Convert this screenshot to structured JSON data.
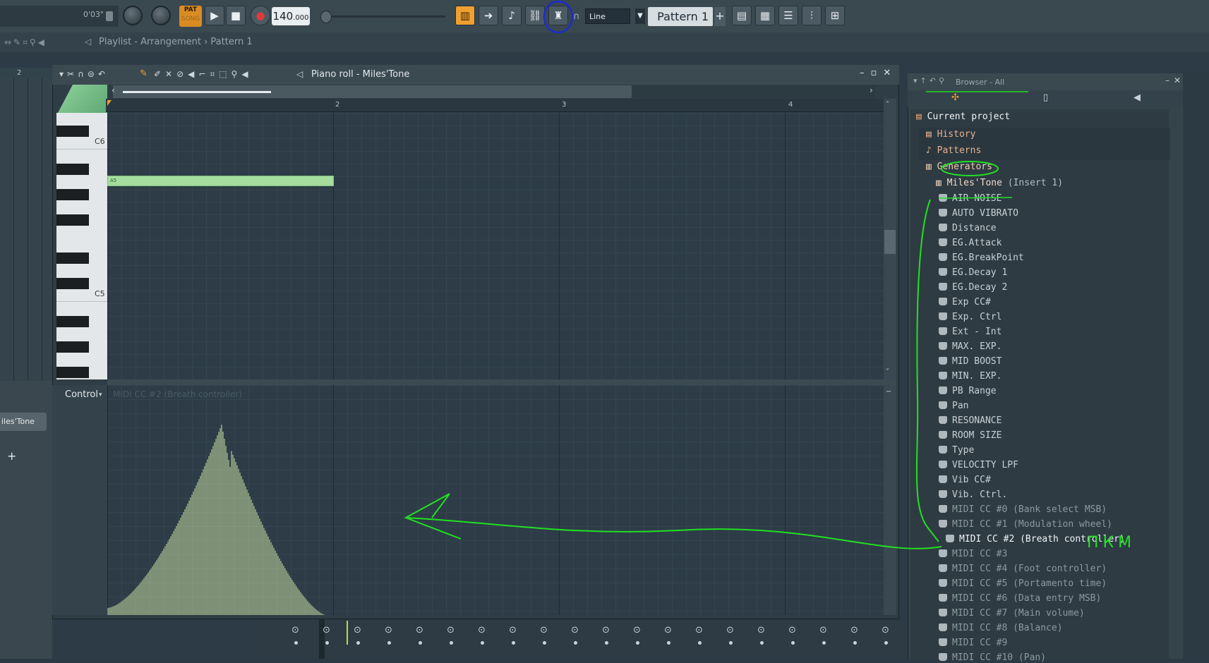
{
  "toolbar": {
    "time": "0'03\"",
    "pat_label": "PAT",
    "song_label": "SONG",
    "tempo_main": "140",
    "tempo_fraction": ".000",
    "snap": "Line",
    "pattern": "Pattern 1",
    "plus": "+"
  },
  "subbar": {
    "title": "Playlist - Arrangement › Pattern 1"
  },
  "piano_roll": {
    "title": "Piano roll - Miles'Tone",
    "ruler": [
      "2",
      "3",
      "4"
    ],
    "octaves": [
      "C6",
      "C5"
    ],
    "note_label": "A5",
    "control_label": "Control",
    "control_target": "MIDI CC #2 (Breath controller)"
  },
  "left_panel": {
    "ruler_number": "2",
    "channel": "iles'Tone",
    "add": "+"
  },
  "browser": {
    "title": "Browser - All",
    "current_project": "Current project",
    "history": "History",
    "patterns": "Patterns",
    "generators": "Generators",
    "instrument": "Miles'Tone",
    "instrument_insert": "(Insert 1)",
    "params": [
      "AIR NOISE",
      "AUTO VIBRATO",
      "Distance",
      "EG.Attack",
      "EG.BreakPoint",
      "EG.Decay 1",
      "EG.Decay 2",
      "Exp CC#",
      "Exp. Ctrl",
      "Ext - Int",
      "MAX. EXP.",
      "MID BOOST",
      "MIN. EXP.",
      "PB Range",
      "Pan",
      "RESONANCE",
      "ROOM SIZE",
      "Type",
      "VELOCITY LPF",
      "Vib CC#",
      "Vib. Ctrl."
    ],
    "midi_cc": [
      "MIDI CC #0 (Bank select MSB)",
      "MIDI CC #1 (Modulation wheel)",
      "MIDI CC #2 (Breath controller)",
      "MIDI CC #3",
      "MIDI CC #4 (Foot controller)",
      "MIDI CC #5 (Portamento time)",
      "MIDI CC #6 (Data entry MSB)",
      "MIDI CC #7 (Main volume)",
      "MIDI CC #8 (Balance)",
      "MIDI CC #9",
      "MIDI CC #10 (Pan)"
    ]
  },
  "annotation": {
    "text": "ПКМ",
    "color": "#22e022",
    "circle_color": "#1c2cd0"
  },
  "colors": {
    "accent": "#f0a030",
    "note": "#a6dd9e",
    "envelope": "#cfe6a8"
  }
}
